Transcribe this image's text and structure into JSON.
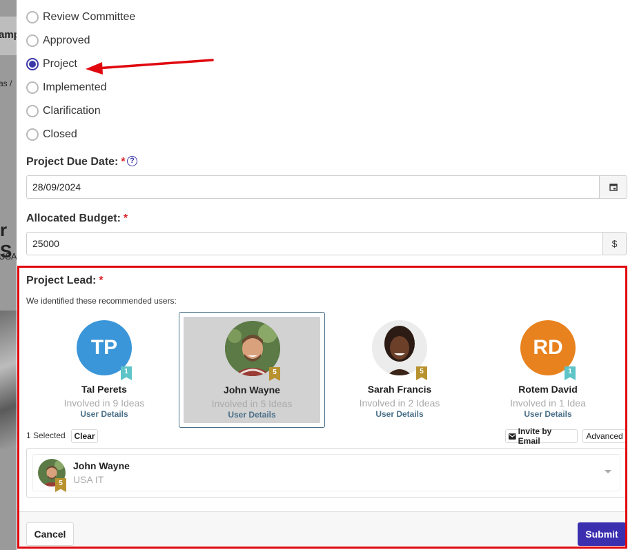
{
  "background": {
    "snippets": [
      "amp",
      "as /",
      "r S",
      "USA"
    ]
  },
  "status_options": [
    {
      "label": "Review Committee",
      "checked": false
    },
    {
      "label": "Approved",
      "checked": false
    },
    {
      "label": "Project",
      "checked": true
    },
    {
      "label": "Implemented",
      "checked": false
    },
    {
      "label": "Clarification",
      "checked": false
    },
    {
      "label": "Closed",
      "checked": false
    }
  ],
  "due_date": {
    "label": "Project Due Date:",
    "required_mark": "*",
    "help_icon": "question-circle-icon",
    "value": "28/09/2024",
    "calendar_icon": "calendar-icon"
  },
  "budget": {
    "label": "Allocated Budget:",
    "required_mark": "*",
    "value": "25000",
    "currency": "$"
  },
  "project_lead": {
    "label": "Project Lead:",
    "required_mark": "*",
    "recommended_text": "We identified these recommended users:",
    "users": [
      {
        "initials": "TP",
        "name": "Tal Perets",
        "involvement": "Involved in 9 Ideas",
        "details_link": "User Details",
        "badge": "1",
        "avatar_color": "#3a96d8",
        "selected": false
      },
      {
        "initials": "",
        "name": "John Wayne",
        "involvement": "Involved in 5 Ideas",
        "details_link": "User Details",
        "badge": "5",
        "avatar_color": "#4f6f3c",
        "selected": true
      },
      {
        "initials": "",
        "name": "Sarah Francis",
        "involvement": "Involved in 2 Ideas",
        "details_link": "User Details",
        "badge": "5",
        "avatar_color": "#e8e8e8",
        "selected": false
      },
      {
        "initials": "RD",
        "name": "Rotem David",
        "involvement": "Involved in 1 Idea",
        "details_link": "User Details",
        "badge": "1",
        "avatar_color": "#e8821e",
        "selected": false
      }
    ],
    "selected_count": "1 Selected",
    "clear_label": "Clear",
    "invite_label": "Invite by Email",
    "invite_icon": "envelope-icon",
    "advanced_label": "Advanced",
    "selected_user": {
      "name": "John Wayne",
      "department": "USA IT",
      "badge": "5"
    }
  },
  "footer": {
    "cancel_label": "Cancel",
    "submit_label": "Submit"
  },
  "colors": {
    "accent": "#3b39a8",
    "submit": "#3b2fb0",
    "highlight_frame": "#e0080e",
    "arrow": "#e0080e"
  }
}
